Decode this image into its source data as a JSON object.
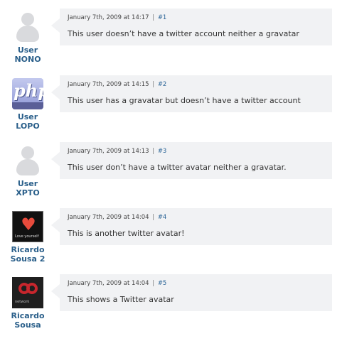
{
  "comments": [
    {
      "author_line1": "User",
      "author_line2": "NONO",
      "avatar_icon": "default-avatar-icon",
      "date": "January 7th, 2009 at 14:17",
      "separator": "|",
      "permalink": "#1",
      "text": "This user doesn’t have a twitter account neither a gravatar"
    },
    {
      "author_line1": "User",
      "author_line2": "LOPO",
      "avatar_icon": "php-logo-avatar-icon",
      "avatar_text": "php",
      "date": "January 7th, 2009 at 14:15",
      "separator": "|",
      "permalink": "#2",
      "text": "This user has a gravatar but doesn’t have a twitter account"
    },
    {
      "author_line1": "User",
      "author_line2": "XPTO",
      "avatar_icon": "default-avatar-icon",
      "date": "January 7th, 2009 at 14:13",
      "separator": "|",
      "permalink": "#3",
      "text": "This user don’t have a twitter avatar neither a gravatar."
    },
    {
      "author_line1": "Ricardo",
      "author_line2": "Sousa 2",
      "avatar_icon": "love-yourself-avatar-icon",
      "avatar_text": "Love yourself",
      "date": "January 7th, 2009 at 14:04",
      "separator": "|",
      "permalink": "#4",
      "text": "This is another twitter avatar!"
    },
    {
      "author_line1": "Ricardo",
      "author_line2": "Sousa",
      "avatar_icon": "network-avatar-icon",
      "avatar_text": "network",
      "date": "January 7th, 2009 at 14:04",
      "separator": "|",
      "permalink": "#5",
      "text": "This shows a Twitter avatar"
    }
  ],
  "colors": {
    "bubble_bg": "#f1f2f4",
    "author_name": "#2a5f8a",
    "link": "#2a6496",
    "text": "#333333"
  }
}
